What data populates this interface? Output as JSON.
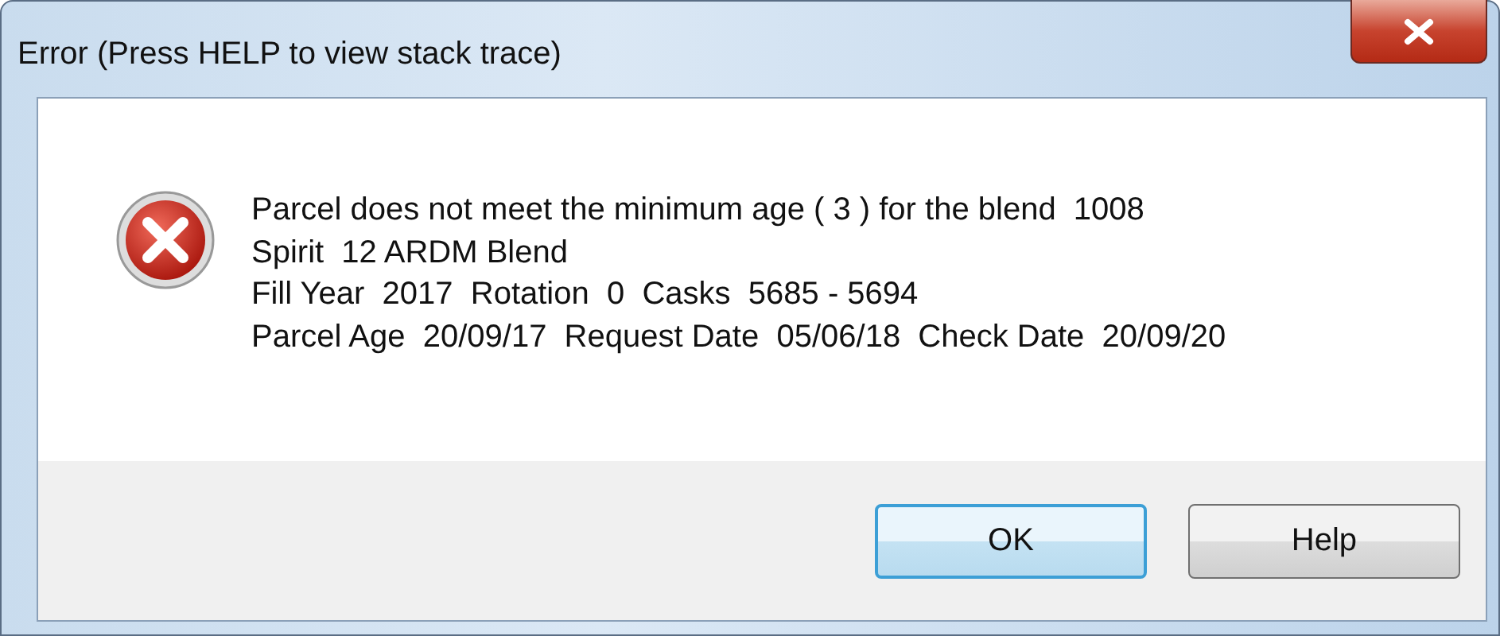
{
  "window": {
    "title": "Error (Press HELP to view stack trace)"
  },
  "message": {
    "lines": [
      "Parcel does not meet the minimum age ( 3 ) for the blend  1008",
      "Spirit  12 ARDM Blend",
      "Fill Year  2017  Rotation  0  Casks  5685 - 5694",
      "Parcel Age  20/09/17  Request Date  05/06/18  Check Date  20/09/20"
    ]
  },
  "buttons": [
    {
      "label": "OK",
      "default": true
    },
    {
      "label": "Help",
      "default": false
    }
  ]
}
